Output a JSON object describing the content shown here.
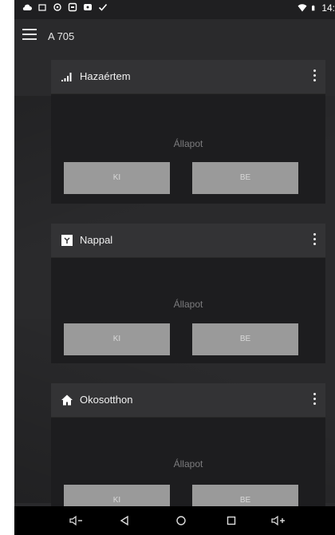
{
  "status_bar": {
    "time": "14:",
    "left_icons": [
      "cloud-icon",
      "sim-icon",
      "sync-icon",
      "image-icon",
      "mail-icon",
      "check-icon"
    ],
    "right_icons": [
      "wifi-icon",
      "battery-icon"
    ]
  },
  "app_bar": {
    "title": "A 705",
    "menu_icon": "hamburger-menu-icon"
  },
  "cards": [
    {
      "title": "Hazaértem",
      "icon": "signal-bars-icon",
      "state_label": "Állapot",
      "off_label": "KI",
      "on_label": "BE"
    },
    {
      "title": "Nappal",
      "icon": "sun-square-icon",
      "state_label": "Állapot",
      "off_label": "KI",
      "on_label": "BE"
    },
    {
      "title": "Okosotthon",
      "icon": "home-icon",
      "state_label": "Állapot",
      "off_label": "KI",
      "on_label": "BE"
    }
  ],
  "nav_bar": {
    "buttons": [
      "volume-down-icon",
      "back-icon",
      "home-circle-icon",
      "recents-icon",
      "volume-up-icon"
    ]
  },
  "colors": {
    "screen_bg": "#2a2a2c",
    "card_header": "#333335",
    "card_body": "#1d1d1f",
    "button": "#9a9a9a"
  }
}
